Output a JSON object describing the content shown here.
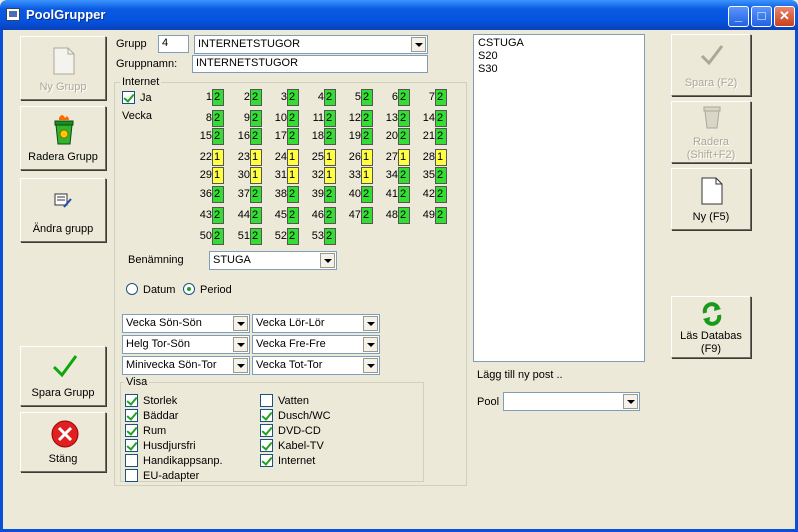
{
  "window": {
    "title": "PoolGrupper",
    "min_label": "_",
    "max_label": "□",
    "close_label": "✕"
  },
  "left_buttons": {
    "new_group": "Ny Grupp",
    "delete_group": "Radera Grupp",
    "edit_group": "Ändra grupp",
    "save_group": "Spara Grupp",
    "close": "Stäng"
  },
  "form": {
    "grupp_label": "Grupp",
    "grupp_value": "4",
    "grupp_combo": "INTERNETSTUGOR",
    "gruppnamn_label": "Gruppnamn:",
    "gruppnamn_value": "INTERNETSTUGOR"
  },
  "internet": {
    "legend": "Internet",
    "ja_label": "Ja",
    "vecka_label": "Vecka",
    "weeks": [
      {
        "n": "1",
        "v": "2",
        "c": "green"
      },
      {
        "n": "2",
        "v": "2",
        "c": "green"
      },
      {
        "n": "3",
        "v": "2",
        "c": "green"
      },
      {
        "n": "4",
        "v": "2",
        "c": "green"
      },
      {
        "n": "5",
        "v": "2",
        "c": "green"
      },
      {
        "n": "6",
        "v": "2",
        "c": "green"
      },
      {
        "n": "7",
        "v": "2",
        "c": "green"
      },
      {
        "n": "8",
        "v": "2",
        "c": "green"
      },
      {
        "n": "9",
        "v": "2",
        "c": "green"
      },
      {
        "n": "10",
        "v": "2",
        "c": "green"
      },
      {
        "n": "11",
        "v": "2",
        "c": "green"
      },
      {
        "n": "12",
        "v": "2",
        "c": "green"
      },
      {
        "n": "13",
        "v": "2",
        "c": "green"
      },
      {
        "n": "14",
        "v": "2",
        "c": "green"
      },
      {
        "n": "15",
        "v": "2",
        "c": "green"
      },
      {
        "n": "16",
        "v": "2",
        "c": "green"
      },
      {
        "n": "17",
        "v": "2",
        "c": "green"
      },
      {
        "n": "18",
        "v": "2",
        "c": "green"
      },
      {
        "n": "19",
        "v": "2",
        "c": "green"
      },
      {
        "n": "20",
        "v": "2",
        "c": "green"
      },
      {
        "n": "21",
        "v": "2",
        "c": "green"
      },
      {
        "n": "22",
        "v": "1",
        "c": "yellow"
      },
      {
        "n": "23",
        "v": "1",
        "c": "yellow"
      },
      {
        "n": "24",
        "v": "1",
        "c": "yellow"
      },
      {
        "n": "25",
        "v": "1",
        "c": "yellow"
      },
      {
        "n": "26",
        "v": "1",
        "c": "yellow"
      },
      {
        "n": "27",
        "v": "1",
        "c": "yellow"
      },
      {
        "n": "28",
        "v": "1",
        "c": "yellow"
      },
      {
        "n": "29",
        "v": "1",
        "c": "yellow"
      },
      {
        "n": "30",
        "v": "1",
        "c": "yellow"
      },
      {
        "n": "31",
        "v": "1",
        "c": "yellow"
      },
      {
        "n": "32",
        "v": "1",
        "c": "yellow"
      },
      {
        "n": "33",
        "v": "1",
        "c": "yellow"
      },
      {
        "n": "34",
        "v": "2",
        "c": "green"
      },
      {
        "n": "35",
        "v": "2",
        "c": "green"
      },
      {
        "n": "36",
        "v": "2",
        "c": "green"
      },
      {
        "n": "37",
        "v": "2",
        "c": "green"
      },
      {
        "n": "38",
        "v": "2",
        "c": "green"
      },
      {
        "n": "39",
        "v": "2",
        "c": "green"
      },
      {
        "n": "40",
        "v": "2",
        "c": "green"
      },
      {
        "n": "41",
        "v": "2",
        "c": "green"
      },
      {
        "n": "42",
        "v": "2",
        "c": "green"
      },
      {
        "n": "43",
        "v": "2",
        "c": "green"
      },
      {
        "n": "44",
        "v": "2",
        "c": "green"
      },
      {
        "n": "45",
        "v": "2",
        "c": "green"
      },
      {
        "n": "46",
        "v": "2",
        "c": "green"
      },
      {
        "n": "47",
        "v": "2",
        "c": "green"
      },
      {
        "n": "48",
        "v": "2",
        "c": "green"
      },
      {
        "n": "49",
        "v": "2",
        "c": "green"
      },
      {
        "n": "50",
        "v": "2",
        "c": "green"
      },
      {
        "n": "51",
        "v": "2",
        "c": "green"
      },
      {
        "n": "52",
        "v": "2",
        "c": "green"
      },
      {
        "n": "53",
        "v": "2",
        "c": "green"
      }
    ],
    "benamning_label": "Benämning",
    "benamning_value": "STUGA",
    "datum_label": "Datum",
    "period_label": "Period"
  },
  "period_combos": [
    "Vecka Sön-Sön",
    "Vecka Lör-Lör",
    "Helg Tor-Sön",
    "Vecka Fre-Fre",
    "Minivecka Sön-Tor",
    "Vecka Tot-Tor"
  ],
  "visa": {
    "legend": "Visa",
    "left": [
      {
        "label": "Storlek",
        "on": true
      },
      {
        "label": "Bäddar",
        "on": true
      },
      {
        "label": "Rum",
        "on": true
      },
      {
        "label": "Husdjursfri",
        "on": true
      },
      {
        "label": "Handikappsanp.",
        "on": false
      },
      {
        "label": "EU-adapter",
        "on": false
      }
    ],
    "right": [
      {
        "label": "Vatten",
        "on": false
      },
      {
        "label": "Dusch/WC",
        "on": true
      },
      {
        "label": "DVD-CD",
        "on": true
      },
      {
        "label": "Kabel-TV",
        "on": true
      },
      {
        "label": "Internet",
        "on": true
      }
    ]
  },
  "pool_list": [
    "CSTUGA",
    "S20",
    "S30"
  ],
  "add_post_label": "Lägg till ny post ..",
  "pool_label": "Pool",
  "right_buttons": {
    "save": "Spara (F2)",
    "delete_l1": "Radera",
    "delete_l2": "(Shift+F2)",
    "new": "Ny (F5)",
    "read_l1": "Läs Databas",
    "read_l2": "(F9)"
  },
  "colors": {
    "green": "#33dd33",
    "yellow": "#ffff44",
    "titlebar": "#0553e0"
  }
}
